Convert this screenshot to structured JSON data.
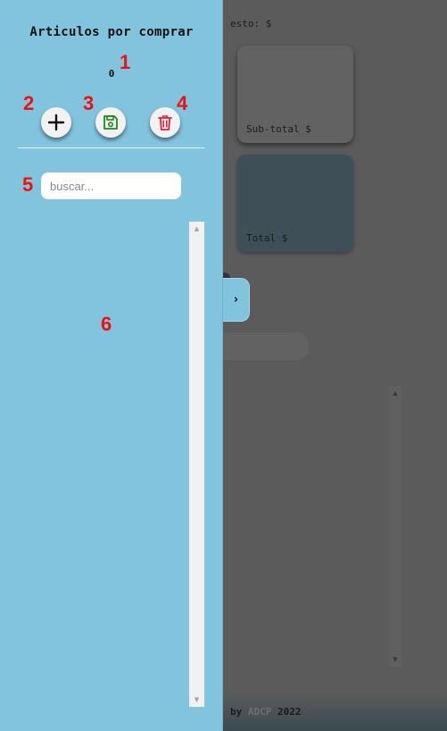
{
  "background": {
    "top_text": "esto: $",
    "subtotal_label": "Sub-total $",
    "total_label": "Total $",
    "footer_by": "by",
    "footer_brand": "ADCP",
    "footer_year": "2022"
  },
  "sidebar": {
    "title": "Articulos por comprar",
    "count": "0",
    "search": {
      "placeholder": "buscar...",
      "value": ""
    },
    "buttons": {
      "add_icon": "plus-icon",
      "save_icon": "floppy-disk-icon",
      "delete_icon": "trash-icon"
    },
    "toggle_label": "›"
  },
  "markers": [
    "1",
    "2",
    "3",
    "4",
    "5",
    "6"
  ],
  "colors": {
    "sidebar_bg": "#82c4de",
    "save_icon": "#1a8a1a",
    "delete_icon": "#d9263f",
    "marker": "#ee1111",
    "overlay": "#5b5b5b"
  }
}
